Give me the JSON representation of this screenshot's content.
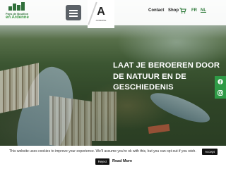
{
  "header": {
    "logo": {
      "line1": "Pays de Bouillon",
      "line2": "en Ardenne"
    },
    "emblem": {
      "letter": "A",
      "sub": "ARDENNE"
    },
    "nav": {
      "contact": "Contact",
      "shop": "Shop"
    },
    "languages": [
      {
        "code": "FR",
        "active": false
      },
      {
        "code": "NL",
        "active": true
      }
    ]
  },
  "hero": {
    "title": "LAAT JE BEROEREN DOOR DE NATUUR EN DE GESCHIEDENIS"
  },
  "social": [
    {
      "icon": "facebook-icon"
    },
    {
      "icon": "instagram-icon"
    }
  ],
  "cookie": {
    "text": "This website uses cookies to improve your experience. We'll assume you're ok with this, but you can opt-out if you wish.",
    "accept_label": "Accept",
    "reject_label": "Reject",
    "read_more_label": "Read More"
  },
  "colors": {
    "brand_green": "#2f9a46",
    "dark_button": "#111111",
    "hamburger": "#5b6167"
  }
}
